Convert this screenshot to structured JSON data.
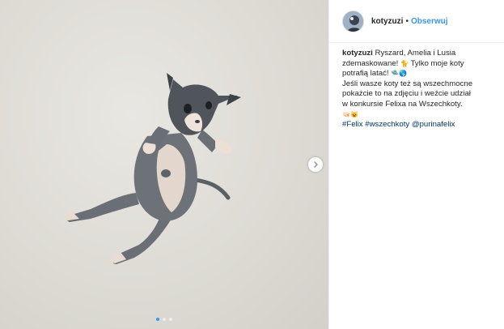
{
  "post": {
    "username": "kotyzuzi",
    "separator": "•",
    "follow_label": "Obserwuj",
    "caption": {
      "line1": "Ryszard, Amelia i Lusia zdemaskowane!",
      "emoji1": "🐈",
      "line2": "Tylko moje koty potrafią latać!",
      "emoji2": "🛸🌎",
      "line3": "Jeśli wasze koty też są wszechmocne pokażcie to na zdjęciu i weźcie udział w konkursie Felixa na Wszechkoty.",
      "emoji3": "🤜🏻😺",
      "hashtags": [
        "#Felix",
        "#wszechkoty",
        "@purinafelix"
      ]
    },
    "carousel": {
      "slide_count": 3,
      "active_index": 0
    }
  },
  "colors": {
    "link": "#3897f0",
    "hashtag": "#003569",
    "text": "#262626",
    "border": "#efefef"
  },
  "icons": [
    "chevron-right-icon"
  ]
}
